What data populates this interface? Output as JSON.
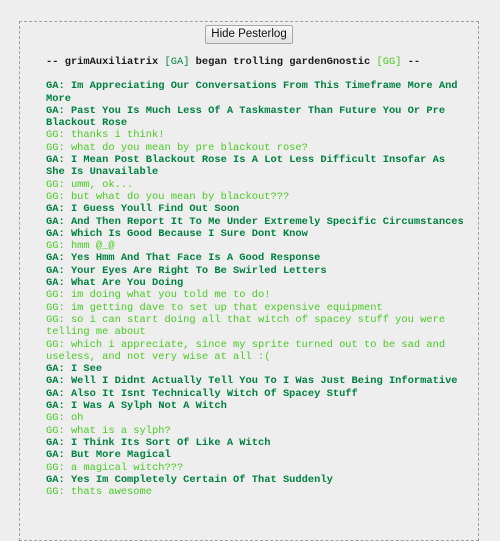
{
  "button": {
    "hide_label": "Hide Pesterlog"
  },
  "colors": {
    "ga": "#008141",
    "gg": "#4ac925",
    "header": "#1a1a1a"
  },
  "header": {
    "prefix": "-- grimAuxiliatrix ",
    "ga_tag": "[GA]",
    "middle": " began trolling gardenGnostic ",
    "gg_tag": "[GG]",
    "suffix": " --"
  },
  "messages": [
    {
      "speaker": "ga",
      "text": "GA: Im Appreciating Our Conversations From This Timeframe More And More"
    },
    {
      "speaker": "ga",
      "text": "GA: Past You Is Much Less Of A Taskmaster Than Future You Or Pre Blackout Rose"
    },
    {
      "speaker": "gg",
      "text": "GG: thanks i think!"
    },
    {
      "speaker": "gg",
      "text": "GG: what do you mean by pre blackout rose?"
    },
    {
      "speaker": "ga",
      "text": "GA: I Mean Post Blackout Rose Is A Lot Less Difficult Insofar As She Is Unavailable"
    },
    {
      "speaker": "gg",
      "text": "GG: umm, ok..."
    },
    {
      "speaker": "gg",
      "text": "GG: but what do you mean by blackout???"
    },
    {
      "speaker": "ga",
      "text": "GA: I Guess Youll Find Out Soon"
    },
    {
      "speaker": "ga",
      "text": "GA: And Then Report It To Me Under Extremely Specific Circumstances"
    },
    {
      "speaker": "ga",
      "text": "GA: Which Is Good Because I Sure Dont Know"
    },
    {
      "speaker": "gg",
      "text": "GG: hmm @_@"
    },
    {
      "speaker": "ga",
      "text": "GA: Yes Hmm And That Face Is A Good Response"
    },
    {
      "speaker": "ga",
      "text": "GA: Your Eyes Are Right To Be Swirled Letters"
    },
    {
      "speaker": "ga",
      "text": "GA: What Are You Doing"
    },
    {
      "speaker": "gg",
      "text": "GG: im doing what you told me to do!"
    },
    {
      "speaker": "gg",
      "text": "GG: im getting dave to set up that expensive equipment"
    },
    {
      "speaker": "gg",
      "text": "GG: so i can start doing all that witch of spacey stuff you were telling me about"
    },
    {
      "speaker": "gg",
      "text": "GG: which i appreciate, since my sprite turned out to be sad and useless, and not very wise at all :("
    },
    {
      "speaker": "ga",
      "text": "GA: I See"
    },
    {
      "speaker": "ga",
      "text": "GA: Well I Didnt Actually Tell You To I Was Just Being Informative"
    },
    {
      "speaker": "ga",
      "text": "GA: Also It Isnt Technically Witch Of Spacey Stuff"
    },
    {
      "speaker": "ga",
      "text": "GA: I Was A Sylph Not A Witch"
    },
    {
      "speaker": "gg",
      "text": "GG: oh"
    },
    {
      "speaker": "gg",
      "text": "GG: what is a sylph?"
    },
    {
      "speaker": "ga",
      "text": "GA: I Think Its Sort Of Like A Witch"
    },
    {
      "speaker": "ga",
      "text": "GA: But More Magical"
    },
    {
      "speaker": "gg",
      "text": "GG: a magical witch???"
    },
    {
      "speaker": "ga",
      "text": "GA: Yes Im Completely Certain Of That Suddenly"
    },
    {
      "speaker": "gg",
      "text": "GG: thats awesome"
    }
  ]
}
